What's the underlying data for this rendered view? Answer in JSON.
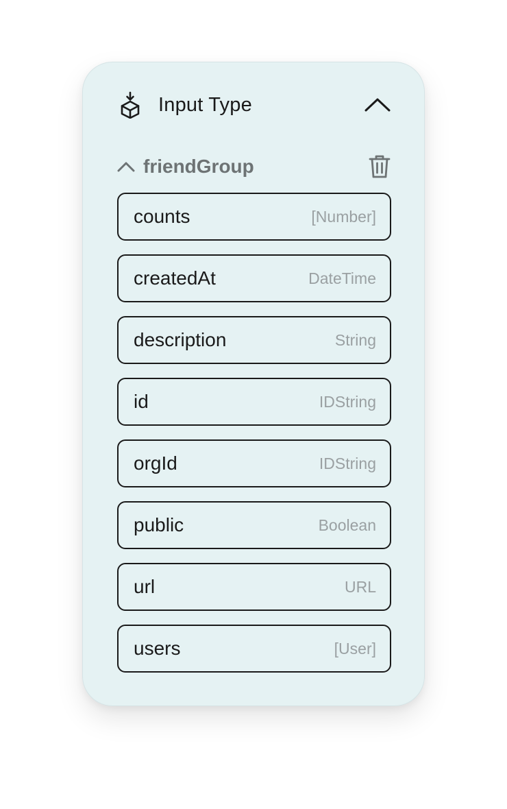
{
  "header": {
    "icon": "cube-download-icon",
    "title": "Input Type",
    "collapse_icon": "chevron-up-icon"
  },
  "group": {
    "expand_icon": "chevron-up-icon",
    "name": "friendGroup",
    "delete_icon": "trash-icon"
  },
  "fields": [
    {
      "name": "counts",
      "type": "[Number]"
    },
    {
      "name": "createdAt",
      "type": "DateTime"
    },
    {
      "name": "description",
      "type": "String"
    },
    {
      "name": "id",
      "type": "IDString"
    },
    {
      "name": "orgId",
      "type": "IDString"
    },
    {
      "name": "public",
      "type": "Boolean"
    },
    {
      "name": "url",
      "type": "URL"
    },
    {
      "name": "users",
      "type": "[User]"
    }
  ],
  "colors": {
    "card_background": "#e5f2f3",
    "border": "#1a1a1a",
    "group_name": "#6d7374",
    "type_text": "#9aa0a2"
  }
}
